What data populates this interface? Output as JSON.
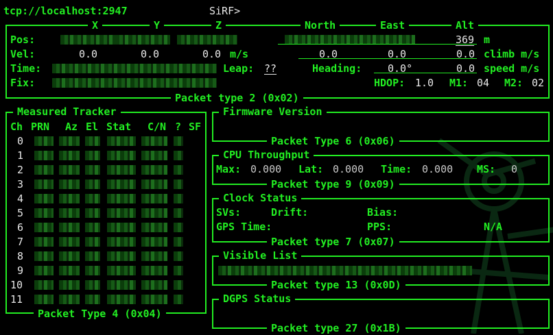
{
  "header": {
    "source": "tcp://localhost:2947",
    "mode": "SiRF>"
  },
  "nav": {
    "columns": [
      "X",
      "Y",
      "Z",
      "North",
      "East",
      "Alt"
    ],
    "rows": {
      "pos": {
        "label": "Pos:",
        "alt": "369",
        "alt_unit": "m"
      },
      "vel": {
        "label": "Vel:",
        "x": "0.0",
        "y": "0.0",
        "z": "0.0",
        "unit": "m/s",
        "north": "0.0",
        "east": "0.0",
        "alt": "0.0",
        "alt_unit": "climb m/s"
      },
      "time": {
        "label": "Time:",
        "leap_label": "Leap:",
        "leap_value": "??",
        "heading_label": "Heading:",
        "heading_value": "0.0°",
        "speed": "0.0",
        "speed_unit": "speed m/s"
      },
      "fix": {
        "label": "Fix:",
        "hdop_label": "HDOP:",
        "hdop_value": "1.0",
        "m1_label": "M1:",
        "m1_value": "04",
        "m2_label": "M2:",
        "m2_value": "02"
      }
    },
    "footer": "Packet type 2 (0x02)"
  },
  "tracker": {
    "title": "Measured Tracker",
    "headers": [
      "Ch",
      "PRN",
      "Az",
      "El",
      "Stat",
      "C/N",
      "?",
      "SF"
    ],
    "channels": [
      "0",
      "1",
      "2",
      "3",
      "4",
      "5",
      "6",
      "7",
      "8",
      "9",
      "10",
      "11"
    ],
    "footer": "Packet Type 4 (0x04)"
  },
  "firmware": {
    "title": "Firmware Version",
    "footer": "Packet Type 6 (0x06)"
  },
  "cpu": {
    "title": "CPU Throughput",
    "max_label": "Max:",
    "max_value": "0.000",
    "lat_label": "Lat:",
    "lat_value": "0.000",
    "time_label": "Time:",
    "time_value": "0.000",
    "ms_label": "MS:",
    "ms_value": "0",
    "footer": "Packet type 9 (0x09)"
  },
  "clock": {
    "title": "Clock Status",
    "svs_label": "SVs:",
    "drift_label": "Drift:",
    "bias_label": "Bias:",
    "gpstime_label": "GPS Time:",
    "pps_label": "PPS:",
    "pps_value": "N/A",
    "footer": "Packet type 7 (0x07)"
  },
  "visible": {
    "title": "Visible List",
    "footer": "Packet type 13 (0x0D)"
  },
  "dgps": {
    "title": "DGPS Status",
    "footer": "Packet type 27 (0x1B)"
  }
}
